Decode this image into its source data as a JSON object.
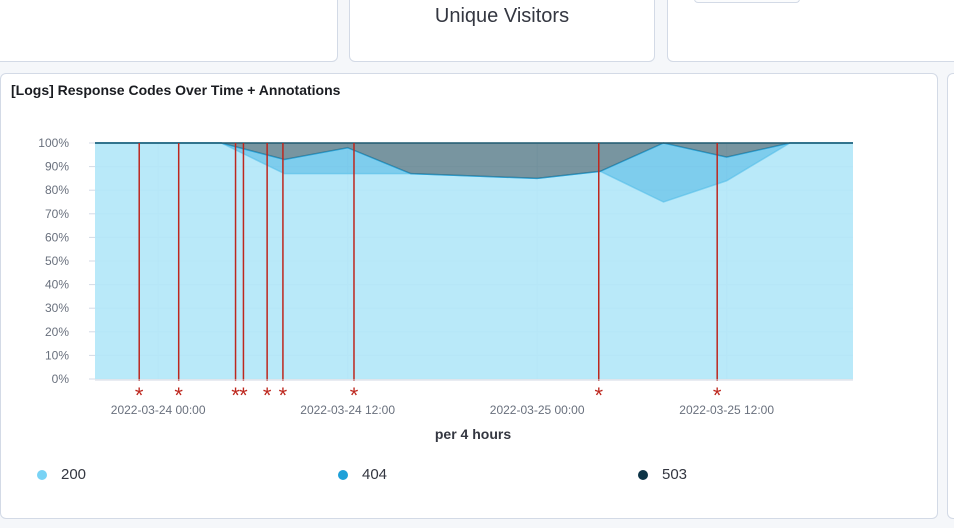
{
  "top_panels": {
    "middle_title": "Unique Visitors"
  },
  "panel": {
    "title": "[Logs] Response Codes Over Time + Annotations"
  },
  "colors": {
    "s200": "#a8e4f8",
    "s404": "#5ec1e8",
    "s503": "#3f6878",
    "annotation": "#bd271e"
  },
  "chart_data": {
    "type": "area",
    "stacked": "percentage",
    "title": "[Logs] Response Codes Over Time + Annotations",
    "xlabel": "per 4 hours",
    "ylabel": "",
    "ylim": [
      0,
      100
    ],
    "y_ticks": [
      "0%",
      "10%",
      "20%",
      "30%",
      "40%",
      "50%",
      "60%",
      "70%",
      "80%",
      "90%",
      "100%"
    ],
    "x_ticks": [
      {
        "value": "2022-03-24 00:00",
        "label": "2022-03-24 00:00"
      },
      {
        "value": "2022-03-24 12:00",
        "label": "2022-03-24 12:00"
      },
      {
        "value": "2022-03-25 00:00",
        "label": "2022-03-25 00:00"
      },
      {
        "value": "2022-03-25 12:00",
        "label": "2022-03-25 12:00"
      }
    ],
    "x": [
      "2022-03-23 20:00",
      "2022-03-24 00:00",
      "2022-03-24 04:00",
      "2022-03-24 08:00",
      "2022-03-24 12:00",
      "2022-03-24 16:00",
      "2022-03-24 20:00",
      "2022-03-25 00:00",
      "2022-03-25 04:00",
      "2022-03-25 08:00",
      "2022-03-25 12:00",
      "2022-03-25 16:00",
      "2022-03-25 20:00"
    ],
    "series": [
      {
        "name": "200",
        "color": "#a8e4f8",
        "values": [
          100,
          100,
          100,
          87,
          87,
          87,
          86,
          85,
          88,
          75,
          84,
          100,
          100
        ]
      },
      {
        "name": "404",
        "color": "#5ec1e8",
        "values": [
          0,
          0,
          0,
          6,
          11,
          0,
          0,
          0,
          0,
          25,
          10,
          0,
          0
        ]
      },
      {
        "name": "503",
        "color": "#3f6878",
        "values": [
          0,
          0,
          0,
          7,
          2,
          13,
          14,
          15,
          12,
          0,
          6,
          0,
          0
        ]
      }
    ],
    "annotations": [
      "2022-03-23 22:48",
      "2022-03-24 01:18",
      "2022-03-24 04:54",
      "2022-03-24 05:24",
      "2022-03-24 06:54",
      "2022-03-24 07:54",
      "2022-03-24 12:24",
      "2022-03-25 03:54",
      "2022-03-25 11:24"
    ],
    "annotation_marker": "*",
    "grid": true,
    "legend_position": "bottom"
  }
}
